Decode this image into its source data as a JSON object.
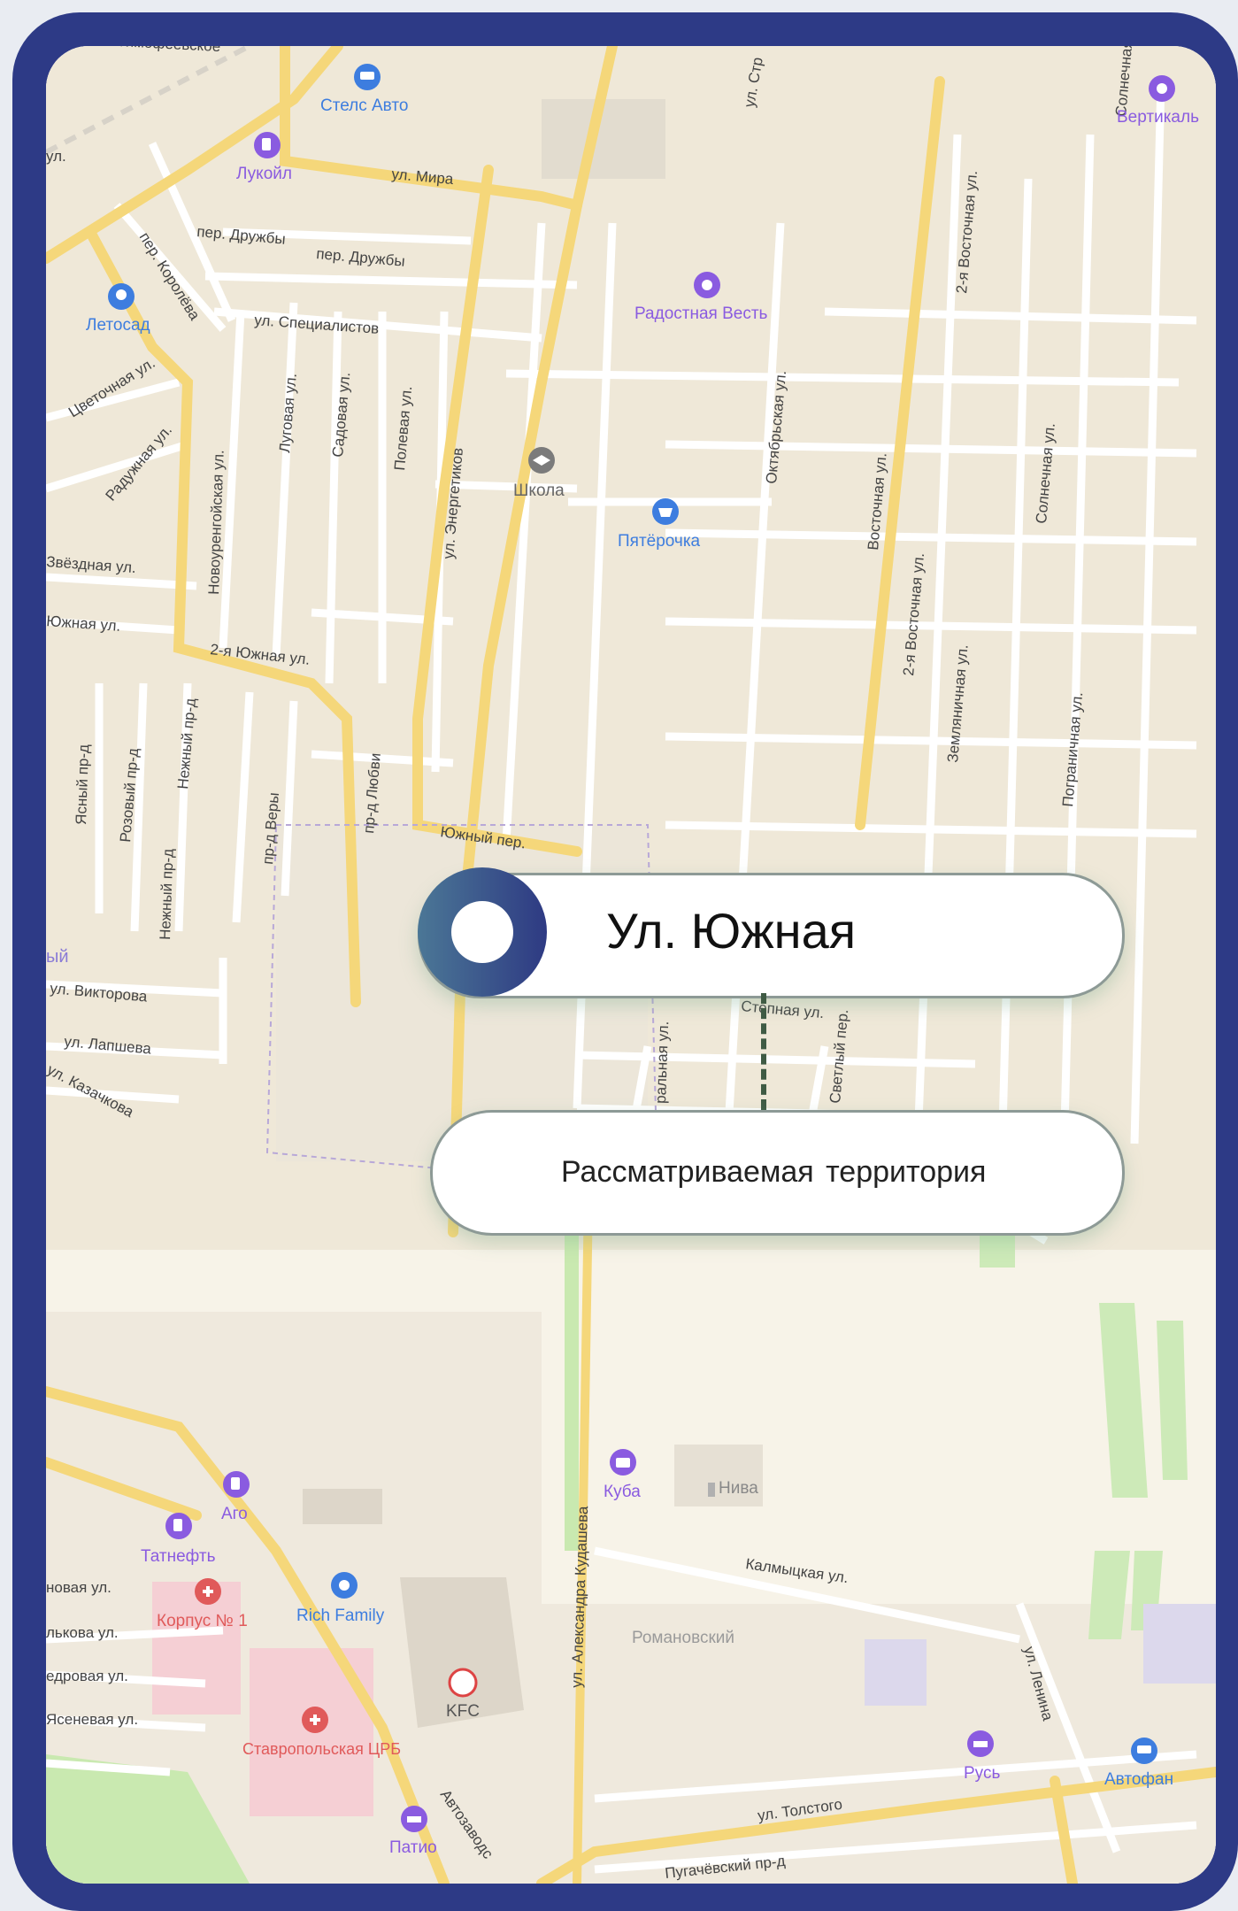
{
  "map": {
    "streets": {
      "mira": "ул. Мира",
      "druzhby1": "пер. Дружбы",
      "druzhby2": "пер. Дружбы",
      "spetsialistov": "ул. Специалистов",
      "koroleva": "пер. Королёва",
      "tsvetochnaya": "Цветочная ул.",
      "raduzhnaya": "Радужная ул.",
      "zvezdnaya": "Звёздная ул.",
      "yuzhnaya": "Южная ул.",
      "yuzhnaya2": "2-я Южная ул.",
      "novourengoyskaya": "Новоуренгойская ул.",
      "lugovaya": "Луговая ул.",
      "sadovaya": "Садовая ул.",
      "polevaya": "Полевая ул.",
      "energetikov": "ул. Энергетиков",
      "oktyabrskaya": "Октябрьская ул.",
      "vostochnaya": "Восточная ул.",
      "vostochnaya2a": "2-я Восточная ул.",
      "vostochnaya2b": "2-я Восточная ул.",
      "solnechnaya": "Солнечная ул.",
      "solnechnaya_top": "Солнечная",
      "zemlyanichnaya": "Земляничная ул.",
      "pogranichnaya": "Пограничная ул.",
      "str": "ул. Стр",
      "yasny": "Ясный пр-д",
      "rozovy": "Розовый пр-д",
      "nezhny1": "Нежный пр-д",
      "nezhny2": "Нежный пр-д",
      "very": "пр-д Веры",
      "lyubvi": "пр-д Любви",
      "yuzhny_per": "Южный пер.",
      "viktorova": "ул. Викторова",
      "lapsheva": "ул. Лапшева",
      "kazachkova": "ул. Казачкова",
      "stepnaya": "Степная ул.",
      "svetly": "Светлый пер.",
      "centralnaya": "ральная ул.",
      "kudasheva": "ул. Александра Кудашева",
      "kalmytskaya": "Калмыцкая ул.",
      "lenina": "ул. Ленина",
      "tolstogo": "ул. Толстого",
      "pugachevsky": "Пугачёвский пр-д",
      "avtozavodskaya": "Автозаводс",
      "novaya": "новая ул.",
      "lkovaya": "лькова ул.",
      "kedrovaya": "едровая ул.",
      "yasenevaya": "Ясеневая ул.",
      "timofeevskoe": "Тимофеевское",
      "iy": "ый",
      "ul_left": "ул."
    },
    "pois": [
      {
        "name": "Стелс Авто",
        "icon": "car-icon",
        "color": "#3d7ddf"
      },
      {
        "name": "Лукойл",
        "icon": "fuel-icon",
        "color": "#8a5be0"
      },
      {
        "name": "Летосад",
        "icon": "flower-icon",
        "color": "#3d7ddf"
      },
      {
        "name": "Радостная Весть",
        "icon": "place-icon",
        "color": "#8a5be0"
      },
      {
        "name": "Вертикаль",
        "icon": "place-icon",
        "color": "#8a5be0"
      },
      {
        "name": "Школа",
        "icon": "school-icon",
        "color": "#7b7b7b"
      },
      {
        "name": "Пятёрочка",
        "icon": "basket-icon",
        "color": "#3d7ddf"
      },
      {
        "name": "Куба",
        "icon": "briefcase-icon",
        "color": "#8a5be0"
      },
      {
        "name": "Нива",
        "icon": "building-icon",
        "color": "#9a9a9a"
      },
      {
        "name": "Аго",
        "icon": "fuel-icon",
        "color": "#8a5be0"
      },
      {
        "name": "Татнефть",
        "icon": "fuel-icon",
        "color": "#8a5be0"
      },
      {
        "name": "Корпус № 1",
        "icon": "hospital-icon",
        "color": "#e05a5a"
      },
      {
        "name": "Rich Family",
        "icon": "toy-icon",
        "color": "#3d7ddf"
      },
      {
        "name": "KFC",
        "icon": "food-icon",
        "color": "#555555"
      },
      {
        "name": "Ставропольская ЦРБ",
        "icon": "hospital-icon",
        "color": "#e05a5a"
      },
      {
        "name": "Патио",
        "icon": "hotel-icon",
        "color": "#8a5be0"
      },
      {
        "name": "Русь",
        "icon": "hotel-icon",
        "color": "#8a5be0"
      },
      {
        "name": "Автофан",
        "icon": "car-icon",
        "color": "#3d7ddf"
      },
      {
        "name": "Романовский",
        "icon": "",
        "color": "#9a9a9a"
      }
    ]
  },
  "callout": {
    "street_title": "Ул. Южная",
    "territory_label": "Рассматриваемая  территория"
  },
  "colors": {
    "frame": "#2d3a86",
    "marker_start": "#4b7796",
    "marker_end": "#2e3a83",
    "road_major": "#f5d77a",
    "greenery": "#c9e9b0"
  }
}
